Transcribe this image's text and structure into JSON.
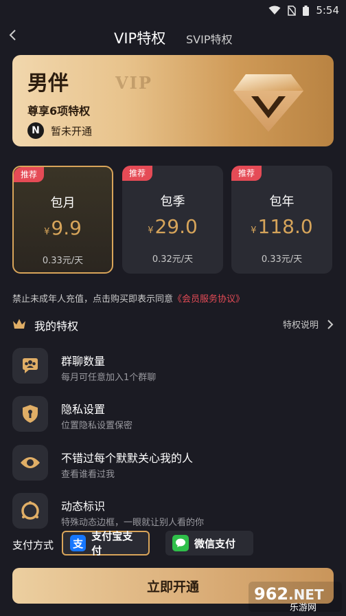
{
  "status": {
    "time": "5:54"
  },
  "header": {
    "back_icon": "chevron-left-icon",
    "tab_vip": "VIP特权",
    "tab_svip": "SVIP特权"
  },
  "vip_card": {
    "title": "男伴",
    "watermark": "VIP",
    "subtitle": "尊享6项特权",
    "badge_letter": "N",
    "status": "暂未开通"
  },
  "plans": [
    {
      "badge": "推荐",
      "name": "包月",
      "currency": "¥",
      "price": "9.9",
      "per_day": "0.33元/天",
      "selected": true
    },
    {
      "badge": "推荐",
      "name": "包季",
      "currency": "¥",
      "price": "29.0",
      "per_day": "0.32元/天",
      "selected": false
    },
    {
      "badge": "推荐",
      "name": "包年",
      "currency": "¥",
      "price": "118.0",
      "per_day": "0.33元/天",
      "selected": false
    }
  ],
  "notice": {
    "text": "禁止未成年人充值，点击购买即表示同意",
    "link": "《会员服务协议》"
  },
  "privileges": {
    "title": "我的特权",
    "explain": "特权说明"
  },
  "features": [
    {
      "icon": "group-chat-icon",
      "title": "群聊数量",
      "desc": "每月可任意加入1个群聊"
    },
    {
      "icon": "privacy-lock-icon",
      "title": "隐私设置",
      "desc": "位置隐私设置保密"
    },
    {
      "icon": "eye-icon",
      "title": "不错过每个默默关心我的人",
      "desc": "查看谁看过我"
    },
    {
      "icon": "frame-ring-icon",
      "title": "动态标识",
      "desc": "特殊动态边框，一眼就让别人看的你"
    }
  ],
  "payment": {
    "label": "支付方式",
    "alipay": "支付宝支付",
    "alipay_glyph": "支",
    "wechat": "微信支付"
  },
  "cta": {
    "label": "立即开通"
  },
  "site_watermark": {
    "text1": "962",
    "text2": ".NET",
    "text3": "乐游网"
  },
  "colors": {
    "background": "#1b1b23",
    "gold": "#d9a55a",
    "accent_red": "#e54b56"
  }
}
